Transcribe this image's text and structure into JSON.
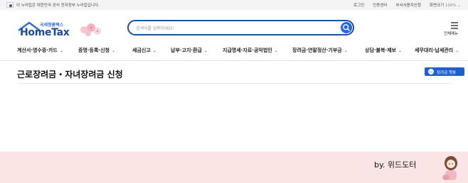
{
  "topbar": {
    "notice": "이 누리집은 대한민국 공식 전자정부 누리집입니다.",
    "links": [
      "로그인",
      "인증센터",
      "부서사용자신청"
    ],
    "zoom_label": "화면크기",
    "zoom_value": "100%"
  },
  "logo": {
    "sub": "국세청홈택스",
    "main": "HomeTax"
  },
  "search": {
    "placeholder": "검색어를 입력하세요!"
  },
  "allmenu": {
    "label": "전체메뉴"
  },
  "nav": {
    "items": [
      "계산서·영수증·카드",
      "증명·등록·신청",
      "세금신고",
      "납부·고지·환급",
      "지급명세·자료·공익법인",
      "장려금·연말정산·기부금",
      "상담·불복·제보",
      "세무대리·납세관리"
    ]
  },
  "page": {
    "title": "근로장려금・자녀장려금 신청",
    "help_button": "장려금 챗봇"
  },
  "footer": {
    "credit": "by. 위드도터"
  },
  "colors": {
    "brand_blue": "#1e4fa3",
    "search_button": "#2567e1",
    "footer_bg": "#fbe4e4"
  }
}
